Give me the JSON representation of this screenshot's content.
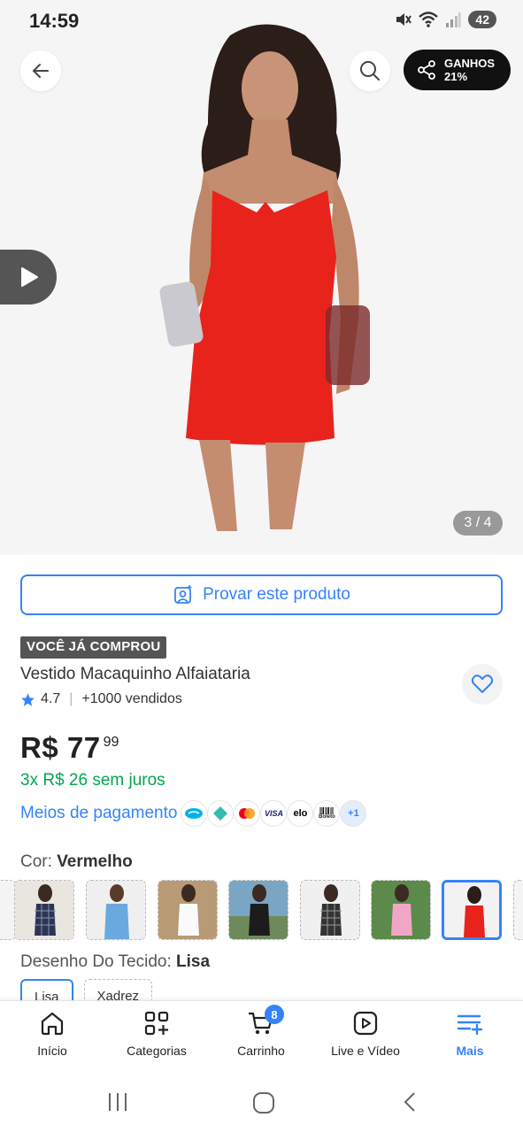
{
  "status_bar": {
    "time": "14:59",
    "battery": "42"
  },
  "header": {
    "share_label": "GANHOS",
    "share_value": "21%"
  },
  "gallery": {
    "counter": "3 / 4"
  },
  "try_on": {
    "label": "Provar este produto"
  },
  "product": {
    "badge": "VOCÊ JÁ COMPROU",
    "title": "Vestido Macaquinho Alfaiataria",
    "rating": "4.7",
    "sold": "+1000 vendidos",
    "price_main": "R$ 77",
    "price_cents": "99",
    "installments": "3x R$ 26 sem juros",
    "payment_link": "Meios de pagamento",
    "payment_icons": [
      "mercado-pago-icon",
      "pix-icon",
      "mastercard-icon",
      "visa-icon",
      "elo-icon",
      "boleto-icon"
    ],
    "payment_icon_texts": {
      "visa": "VISA",
      "elo": "elo",
      "boleto": "Boleto"
    },
    "payment_more": "+1"
  },
  "variants": {
    "color_label": "Cor:",
    "color_value": "Vermelho",
    "fabric_label": "Desenho Do Tecido:",
    "fabric_value": "Lisa",
    "fabric_options": [
      "Lisa",
      "Xadrez"
    ]
  },
  "bottom_nav": {
    "items": [
      "Início",
      "Categorias",
      "Carrinho",
      "Live e Vídeo",
      "Mais"
    ],
    "cart_count": "8",
    "active": "Mais"
  },
  "colors": {
    "accent": "#3483fa",
    "green": "#00a650",
    "dress": "#e8231c"
  }
}
